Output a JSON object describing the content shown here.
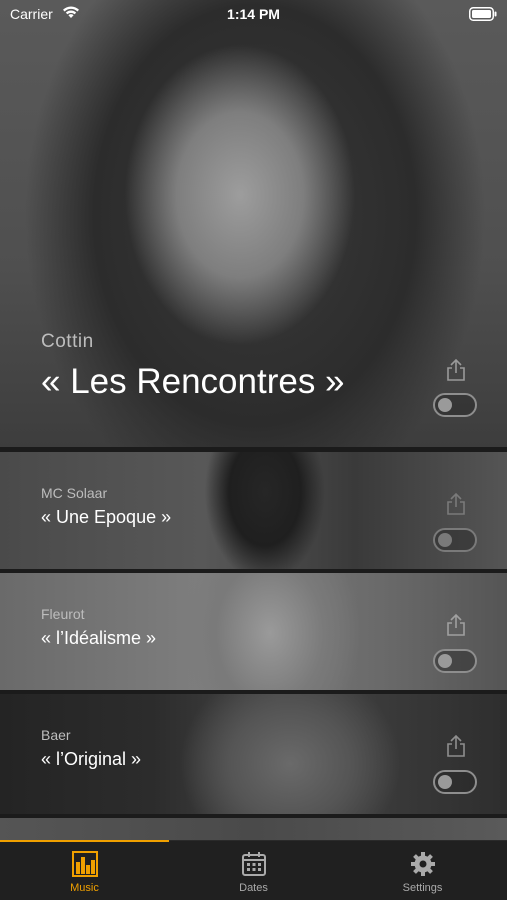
{
  "status_bar": {
    "carrier": "Carrier",
    "time": "1:14 PM"
  },
  "cards": [
    {
      "artist": "Cottin",
      "song": "« Les Rencontres »",
      "enabled": false
    },
    {
      "artist": "MC Solaar",
      "song": "« Une Epoque »",
      "enabled": false
    },
    {
      "artist": "Fleurot",
      "song": "« l’Idéalisme »",
      "enabled": false
    },
    {
      "artist": "Baer",
      "song": "« l’Original »",
      "enabled": false
    }
  ],
  "tabs": [
    {
      "label": "Music",
      "icon": "bar-chart-icon",
      "active": true
    },
    {
      "label": "Dates",
      "icon": "calendar-icon",
      "active": false
    },
    {
      "label": "Settings",
      "icon": "gear-icon",
      "active": false
    }
  ],
  "colors": {
    "accent": "#f0a000",
    "tab_inactive": "#aaaaaa",
    "tabbar_bg": "#202020"
  }
}
